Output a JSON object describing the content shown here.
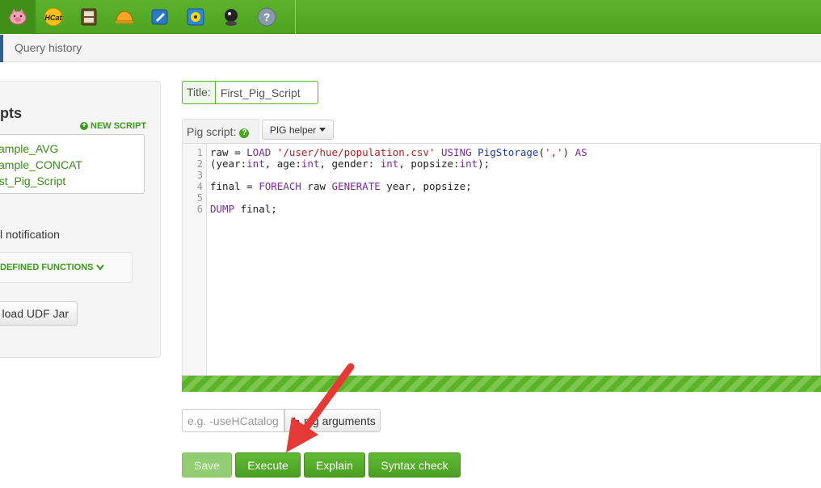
{
  "topbar": {
    "apps": [
      {
        "icon": "pig-icon",
        "active": true
      },
      {
        "icon": "hcat-icon",
        "label": "HCat"
      },
      {
        "icon": "file-browser-icon"
      },
      {
        "icon": "job-designer-icon"
      },
      {
        "icon": "oozie-icon"
      },
      {
        "icon": "job-browser-icon"
      },
      {
        "icon": "user-admin-icon"
      },
      {
        "icon": "help-icon",
        "label": "?"
      }
    ]
  },
  "subnav": {
    "query_history": "Query history"
  },
  "sidebar": {
    "title_fragment": "pts",
    "new_script": "NEW SCRIPT",
    "scripts": [
      "xample_AVG",
      "xample_CONCAT",
      "irst_Pig_Script"
    ],
    "notification": "l notification",
    "udf_label": "DEFINED FUNCTIONS",
    "upload_udf": "load UDF Jar"
  },
  "editor": {
    "title_label": "Title:",
    "title_value": "First_Pig_Script",
    "script_tab": "Pig script:",
    "pig_helper": "PIG helper",
    "line_numbers": [
      "1",
      "2",
      "3",
      "4",
      "5",
      "6"
    ],
    "code": "raw = LOAD '/user/hue/population.csv' USING PigStorage(',') AS\n(year:int, age:int, gender: int, popsize:int);\n\nfinal = FOREACH raw GENERATE year, popsize;\n\nDUMP final;",
    "progress": 1.0
  },
  "arguments": {
    "placeholder": "e.g. -useHCatalog",
    "button": "pig arguments"
  },
  "actions": {
    "save": "Save",
    "execute": "Execute",
    "explain": "Explain",
    "syntax_check": "Syntax check"
  },
  "colors": {
    "brand_green": "#5cb32a",
    "link_green": "#3a8a18",
    "annotation_arrow": "#e53935"
  }
}
